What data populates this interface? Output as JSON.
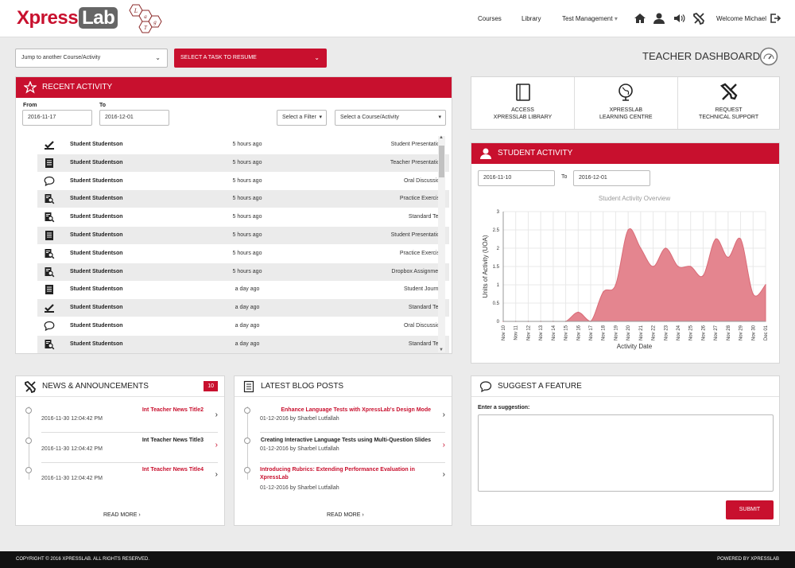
{
  "brand": {
    "part1": "Xpress",
    "part2": "Lab",
    "subtitle": "Lang Test"
  },
  "nav": {
    "courses": "Courses",
    "library": "Library",
    "test_management": "Test Management",
    "welcome": "Welcome",
    "user": "Michael"
  },
  "jump": {
    "label": "Jump to another Course/Activity"
  },
  "resume": {
    "label": "SELECT A TASK TO RESUME"
  },
  "page_title": "TEACHER DASHBOARD",
  "recent": {
    "title": "RECENT ACTIVITY",
    "from_label": "From",
    "from": "2016-11-17",
    "to_label": "To",
    "to": "2016-12-01",
    "filter": "Select a Filter",
    "course": "Select a Course/Activity",
    "rows": [
      {
        "icon": "check-icon",
        "name": "Student Studentson",
        "time": "5 hours ago",
        "type": "Student Presentation"
      },
      {
        "icon": "document-icon",
        "name": "Student Studentson",
        "time": "5 hours ago",
        "type": "Teacher Presentation"
      },
      {
        "icon": "speech-bubble-icon",
        "name": "Student Studentson",
        "time": "5 hours ago",
        "type": "Oral Discussion"
      },
      {
        "icon": "search-document-icon",
        "name": "Student Studentson",
        "time": "5 hours ago",
        "type": "Practice Exercise"
      },
      {
        "icon": "search-document-icon",
        "name": "Student Studentson",
        "time": "5 hours ago",
        "type": "Standard Test"
      },
      {
        "icon": "document-icon",
        "name": "Student Studentson",
        "time": "5 hours ago",
        "type": "Student Presentation"
      },
      {
        "icon": "search-document-icon",
        "name": "Student Studentson",
        "time": "5 hours ago",
        "type": "Practice Exercise"
      },
      {
        "icon": "search-document-icon",
        "name": "Student Studentson",
        "time": "5 hours ago",
        "type": "Dropbox Assignment"
      },
      {
        "icon": "document-icon",
        "name": "Student Studentson",
        "time": "a day ago",
        "type": "Student Journal"
      },
      {
        "icon": "check-icon",
        "name": "Student Studentson",
        "time": "a day ago",
        "type": "Standard Test"
      },
      {
        "icon": "speech-bubble-icon",
        "name": "Student Studentson",
        "time": "a day ago",
        "type": "Oral Discussion"
      },
      {
        "icon": "search-document-icon",
        "name": "Student Studentson",
        "time": "a day ago",
        "type": "Standard Test"
      }
    ]
  },
  "quick": [
    {
      "icon": "book-icon",
      "line1": "ACCESS",
      "line2": "XPRESSLAB LIBRARY"
    },
    {
      "icon": "globe-icon",
      "line1": "XPRESSLAB",
      "line2": "LEARNING CENTRE"
    },
    {
      "icon": "tools-icon",
      "line1": "REQUEST",
      "line2": "TECHNICAL SUPPORT"
    }
  ],
  "student_activity": {
    "title": "STUDENT ACTIVITY",
    "from": "2016-11-10",
    "to_label": "To",
    "to": "2016-12-01"
  },
  "chart_data": {
    "type": "area",
    "title": "Student Activity Overview",
    "xlabel": "Activity Date",
    "ylabel": "Units of Activity (UOA)",
    "ylim": [
      0,
      3
    ],
    "yticks": [
      "0",
      "0.5",
      "1",
      "1.5",
      "2",
      "2.5",
      "3"
    ],
    "grid": true,
    "color": "#e4858f",
    "x": [
      "Nov 10",
      "Nov 11",
      "Nov 12",
      "Nov 13",
      "Nov 14",
      "Nov 15",
      "Nov 16",
      "Nov 17",
      "Nov 18",
      "Nov 19",
      "Nov 20",
      "Nov 21",
      "Nov 22",
      "Nov 23",
      "Nov 24",
      "Nov 25",
      "Nov 26",
      "Nov 27",
      "Nov 28",
      "Nov 29",
      "Nov 30",
      "Dec 01"
    ],
    "values": [
      0,
      0,
      0,
      0,
      0,
      0,
      0.25,
      0,
      0.8,
      1,
      2.5,
      2,
      1.5,
      2,
      1.5,
      1.5,
      1.25,
      2.25,
      1.75,
      2.25,
      0.75,
      1
    ]
  },
  "news": {
    "title": "NEWS & ANNOUNCEMENTS",
    "badge": "10",
    "read_more": "READ MORE",
    "items": [
      {
        "title": "Int Teacher News Title2",
        "date": "2016-11-30 12:04:42 PM",
        "color": "#c8102e"
      },
      {
        "title": "Int Teacher News Title3",
        "date": "2016-11-30 12:04:42 PM",
        "color": "#222222"
      },
      {
        "title": "Int Teacher News Title4",
        "date": "2016-11-30 12:04:42 PM",
        "color": "#c8102e"
      }
    ]
  },
  "blog": {
    "title": "LATEST BLOG POSTS",
    "read_more": "READ MORE",
    "items": [
      {
        "title": "Enhance Language Tests with XpressLab's Design Mode",
        "meta": "01-12-2016 by Sharbel Lutfallah",
        "color": "#c8102e"
      },
      {
        "title": "Creating Interactive Language Tests using Multi-Question Slides",
        "meta": "01-12-2016 by Sharbel Lutfallah",
        "color": "#222222"
      },
      {
        "title": "Introducing Rubrics: Extending Performance Evaluation in XpressLab",
        "meta": "01-12-2016 by Sharbel Lutfallah",
        "color": "#c8102e"
      }
    ]
  },
  "suggest": {
    "title": "SUGGEST A FEATURE",
    "label": "Enter a suggestion:",
    "submit": "SUBMIT"
  },
  "footer": {
    "copyright": "COPYRIGHT © 2016 XPRESSLAB. ALL RIGHTS RESERVED.",
    "powered": "POWERED BY XPRESSLAB"
  },
  "colors": {
    "accent": "#c8102e",
    "chart_fill": "#e4858f"
  }
}
